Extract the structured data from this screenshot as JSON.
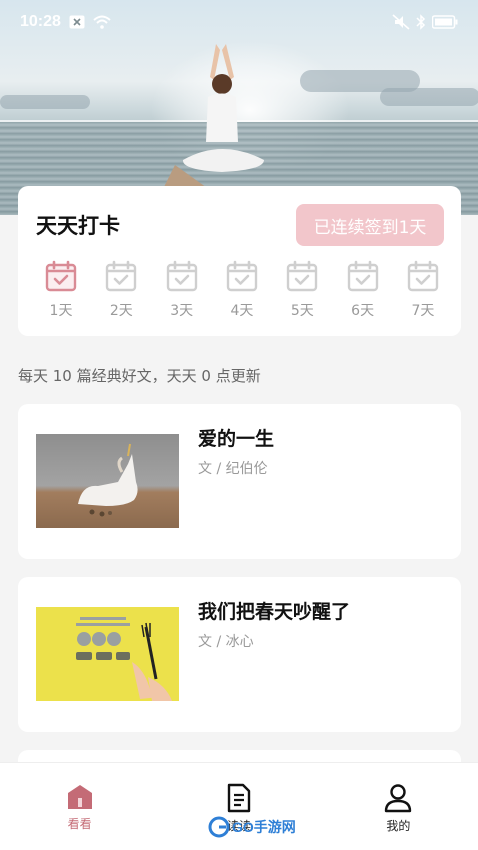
{
  "status_bar": {
    "time": "10:28"
  },
  "checkin": {
    "title": "天天打卡",
    "streak_label": "已连续签到1天",
    "days": [
      {
        "label": "1天",
        "checked": true
      },
      {
        "label": "2天",
        "checked": false
      },
      {
        "label": "3天",
        "checked": false
      },
      {
        "label": "4天",
        "checked": false
      },
      {
        "label": "5天",
        "checked": false
      },
      {
        "label": "6天",
        "checked": false
      },
      {
        "label": "7天",
        "checked": false
      }
    ]
  },
  "subtitle": "每天 10 篇经典好文，天天 0 点更新",
  "articles": [
    {
      "title": "爱的一生",
      "author": "文 / 纪伯伦"
    },
    {
      "title": "我们把春天吵醒了",
      "author": "文 / 冰心"
    }
  ],
  "tabs": [
    {
      "label": "看看",
      "icon": "home-icon",
      "active": true
    },
    {
      "label": "读读",
      "icon": "document-icon",
      "active": false
    },
    {
      "label": "我的",
      "icon": "profile-icon",
      "active": false
    }
  ],
  "colors": {
    "accent": "#c46b76",
    "streak_bg": "#f2c6cb",
    "checked_icon": "#d98b95",
    "unchecked_icon": "#cfcfcf"
  },
  "watermark": {
    "text": "GO手游网"
  }
}
